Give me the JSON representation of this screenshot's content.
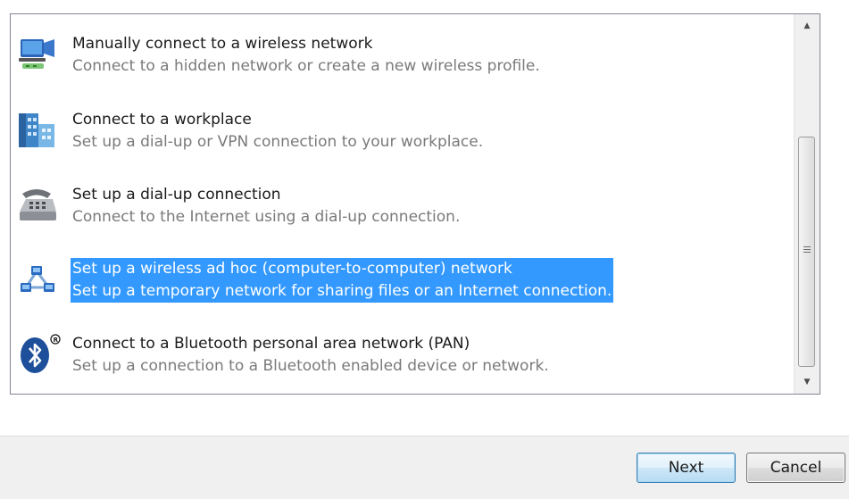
{
  "options": [
    {
      "title": "Manually connect to a wireless network",
      "description": "Connect to a hidden network or create a new wireless profile.",
      "icon": "wireless-network-icon"
    },
    {
      "title": "Connect to a workplace",
      "description": "Set up a dial-up or VPN connection to your workplace.",
      "icon": "workplace-building-icon"
    },
    {
      "title": "Set up a dial-up connection",
      "description": "Connect to the Internet using a dial-up connection.",
      "icon": "telephone-modem-icon"
    },
    {
      "title": "Set up a wireless ad hoc (computer-to-computer) network",
      "description": "Set up a temporary network for sharing files or an Internet connection.",
      "icon": "ad-hoc-network-icon",
      "selected": true
    },
    {
      "title": "Connect to a Bluetooth personal area network (PAN)",
      "description": "Set up a connection to a Bluetooth enabled device or network.",
      "icon": "bluetooth-icon"
    }
  ],
  "buttons": {
    "next_label": "Next",
    "cancel_label": "Cancel"
  },
  "colors": {
    "selection": "#3399ff",
    "description_text": "#7a7a7a",
    "footer_background": "#f0f0f0"
  }
}
